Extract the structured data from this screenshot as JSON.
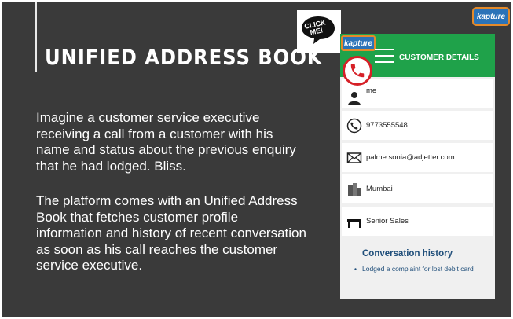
{
  "slide": {
    "title": "UNIFIED ADDRESS BOOK",
    "paragraph_1": "Imagine a customer service executive receiving a call from a customer with his name and status about the previous enquiry that he had lodged. Bliss.",
    "paragraph_2": "The platform comes with an Unified Address Book that fetches customer profile information and history of recent conversation as soon as his call reaches the customer service executive."
  },
  "branding": {
    "corner_logo": "kapture",
    "header_logo": "kapture",
    "click_me_label": "CLICK ME!"
  },
  "customer_panel": {
    "header_title": "CUSTOMER DETAILS",
    "name_partial": "me",
    "phone": "9773555548",
    "email": "palme.sonia@adjetter.com",
    "city": "Mumbai",
    "designation": "Senior Sales",
    "conversation_history_title": "Conversation history",
    "conversation_items": [
      "Lodged a complaint for lost debit card"
    ]
  },
  "colors": {
    "slide_bg": "#3a3a3a",
    "header_green": "#1fa24a",
    "history_blue": "#1f4e7a",
    "kapture_blue": "#2b73b8",
    "call_red": "#d62027"
  },
  "icons": {
    "incoming_call": "phone-ring-icon",
    "person": "person-icon",
    "phone": "phone-icon",
    "email": "envelope-icon",
    "city": "buildings-icon",
    "designation": "desk-icon",
    "menu": "hamburger-icon"
  }
}
